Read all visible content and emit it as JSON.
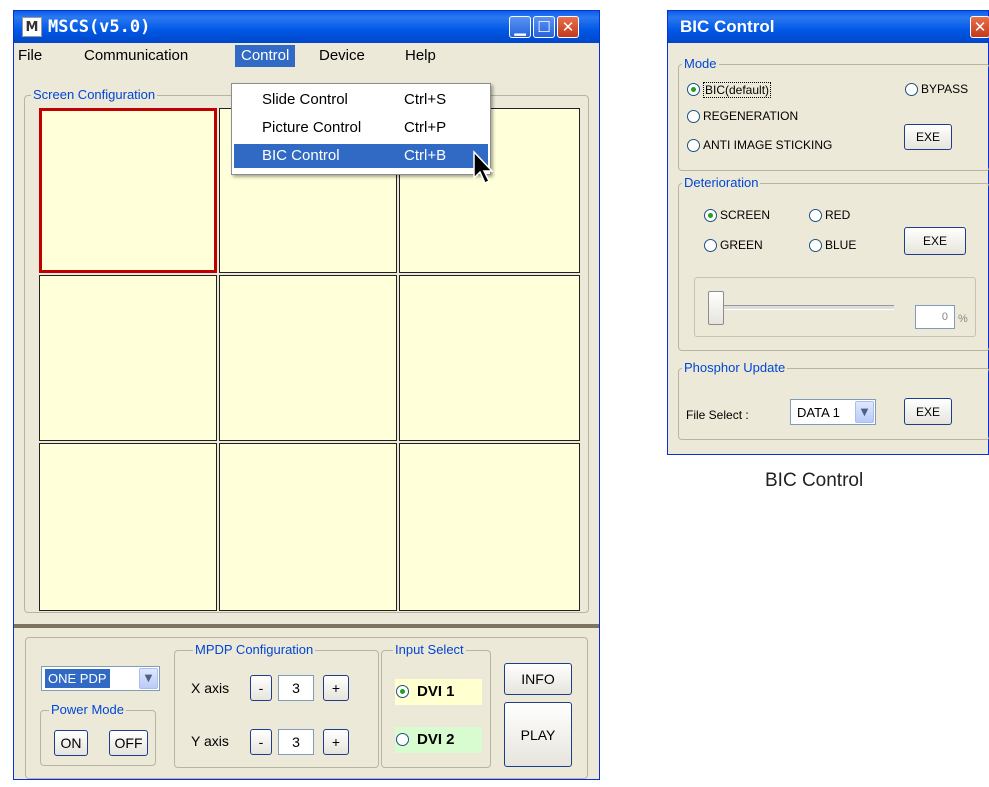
{
  "main_window": {
    "title": "MSCS(v5.0)",
    "icon_letter": "M",
    "menu": [
      "File",
      "Communication",
      "Control",
      "Device",
      "Help"
    ],
    "control_menu": [
      {
        "label": "Slide Control",
        "shortcut": "Ctrl+S"
      },
      {
        "label": "Picture Control",
        "shortcut": "Ctrl+P"
      },
      {
        "label": "BIC Control",
        "shortcut": "Ctrl+B"
      }
    ],
    "screen_config_label": "Screen Configuration",
    "pdp_select": "ONE PDP",
    "power_mode_label": "Power Mode",
    "power_on": "ON",
    "power_off": "OFF",
    "mpdp_label": "MPDP Configuration",
    "x_axis_label": "X axis",
    "x_axis_value": "3",
    "y_axis_label": "Y axis",
    "y_axis_value": "3",
    "minus": "-",
    "plus": "+",
    "input_select_label": "Input Select",
    "dvi1": "DVI 1",
    "dvi2": "DVI 2",
    "info_button": "INFO",
    "play_button": "PLAY"
  },
  "bic_window": {
    "title": "BIC Control",
    "mode_label": "Mode",
    "mode_bic": "BIC(default)",
    "mode_bypass": "BYPASS",
    "mode_regeneration": "REGENERATION",
    "mode_anti": "ANTI IMAGE STICKING",
    "exe": "EXE",
    "deterioration_label": "Deterioration",
    "det_screen": "SCREEN",
    "det_red": "RED",
    "det_green": "GREEN",
    "det_blue": "BLUE",
    "slider_value": "0",
    "percent": "%",
    "phosphor_label": "Phosphor Update",
    "file_select_label": "File Select :",
    "file_select_value": "DATA 1"
  },
  "caption": "BIC Control"
}
